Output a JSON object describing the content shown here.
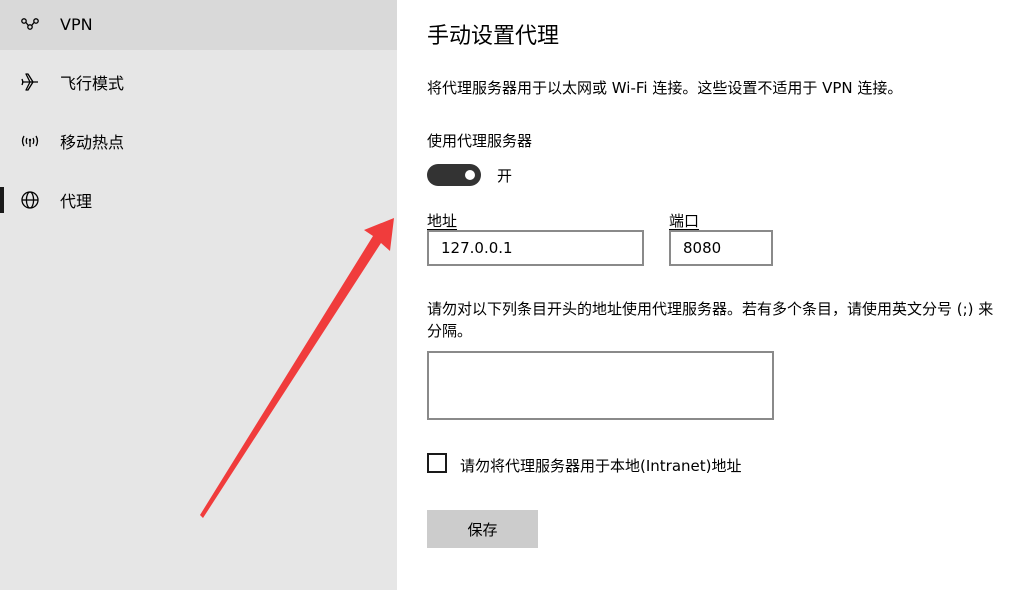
{
  "sidebar": {
    "items": [
      {
        "label": "VPN",
        "icon": "vpn-icon"
      },
      {
        "label": "飞行模式",
        "icon": "airplane-icon"
      },
      {
        "label": "移动热点",
        "icon": "hotspot-icon"
      },
      {
        "label": "代理",
        "icon": "globe-icon"
      }
    ]
  },
  "main": {
    "title": "手动设置代理",
    "description": "将代理服务器用于以太网或 Wi-Fi 连接。这些设置不适用于 VPN 连接。",
    "use_proxy_label": "使用代理服务器",
    "toggle_state": "开",
    "address_label": "地址",
    "address_value": "127.0.0.1",
    "port_label": "端口",
    "port_value": "8080",
    "exceptions_text": "请勿对以下列条目开头的地址使用代理服务器。若有多个条目，请使用英文分号 (;) 来分隔。",
    "exceptions_value": "",
    "local_checkbox_label": "请勿将代理服务器用于本地(Intranet)地址",
    "save_label": "保存"
  },
  "colors": {
    "sidebar_bg": "#e6e6e6",
    "toggle_on": "#333333",
    "button_bg": "#cccccc",
    "arrow": "#f03c3c"
  }
}
